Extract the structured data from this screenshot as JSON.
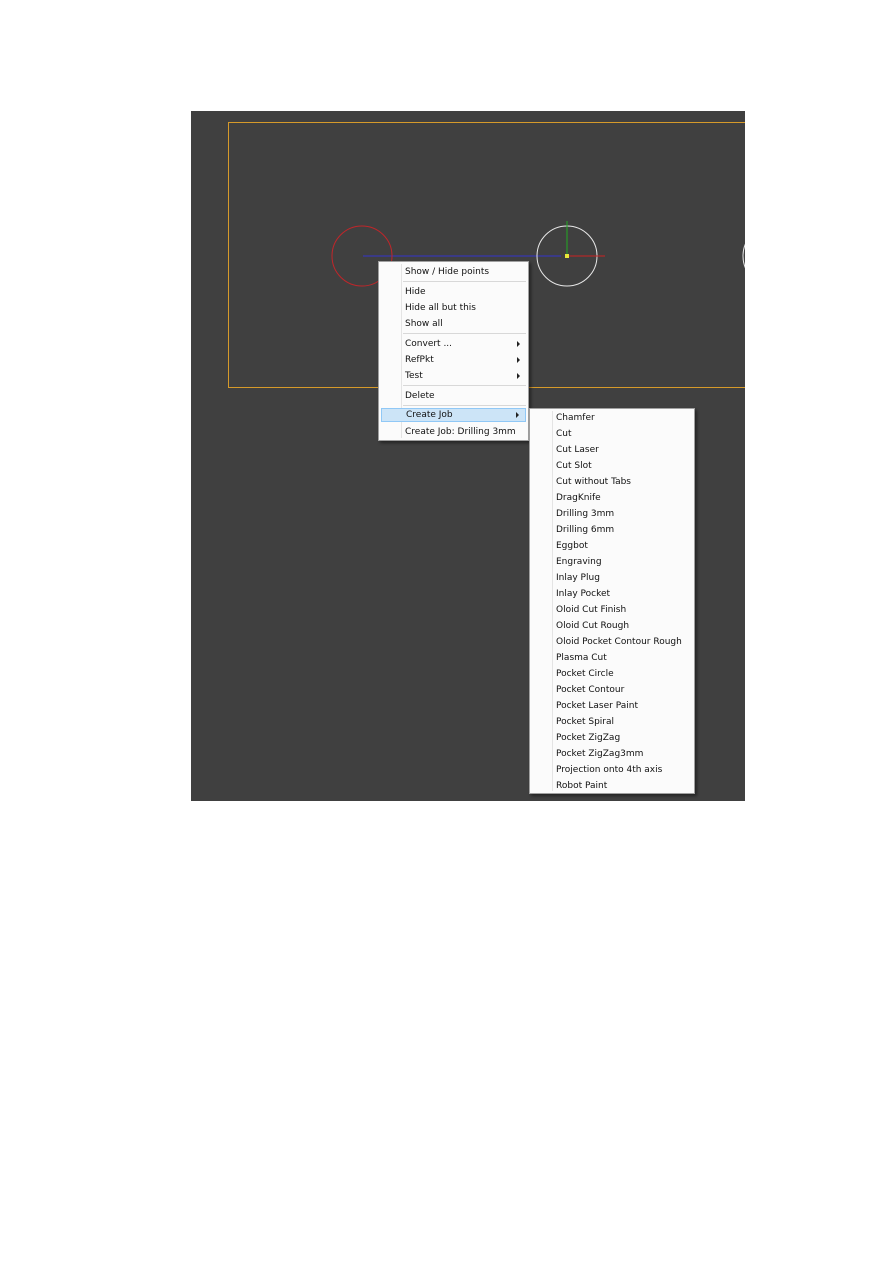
{
  "scene": {
    "colors": {
      "background": "#404040",
      "workpiece_border": "#d69a2a",
      "selected_circle": "#c0262a",
      "circle": "#e8e8e8",
      "axis_x": "#cc2222",
      "axis_y": "#22aa22",
      "axis_line": "#3333cc",
      "origin_marker": "#e8e83a"
    }
  },
  "context_menu": {
    "items": [
      {
        "label": "Show / Hide points",
        "submenu": false
      },
      {
        "label": "Hide",
        "submenu": false
      },
      {
        "label": "Hide all but this",
        "submenu": false
      },
      {
        "label": "Show all",
        "submenu": false
      },
      {
        "label": "Convert ...",
        "submenu": true
      },
      {
        "label": "RefPkt",
        "submenu": true
      },
      {
        "label": "Test",
        "submenu": true
      },
      {
        "label": "Delete",
        "submenu": false
      },
      {
        "label": "Create Job",
        "submenu": true,
        "highlighted": true
      },
      {
        "label": "Create Job:  Drilling 3mm",
        "submenu": false
      }
    ]
  },
  "create_job_submenu": {
    "items": [
      "Chamfer",
      "Cut",
      "Cut Laser",
      "Cut Slot",
      "Cut without Tabs",
      "DragKnife",
      "Drilling 3mm",
      "Drilling 6mm",
      "Eggbot",
      "Engraving",
      "Inlay Plug",
      "Inlay Pocket",
      "Oloid Cut Finish",
      "Oloid Cut Rough",
      "Oloid Pocket Contour Rough",
      "Plasma Cut",
      "Pocket Circle",
      "Pocket Contour",
      "Pocket Laser Paint",
      "Pocket Spiral",
      "Pocket ZigZag",
      "Pocket ZigZag3mm",
      "Projection onto 4th axis",
      "Robot Paint"
    ]
  }
}
